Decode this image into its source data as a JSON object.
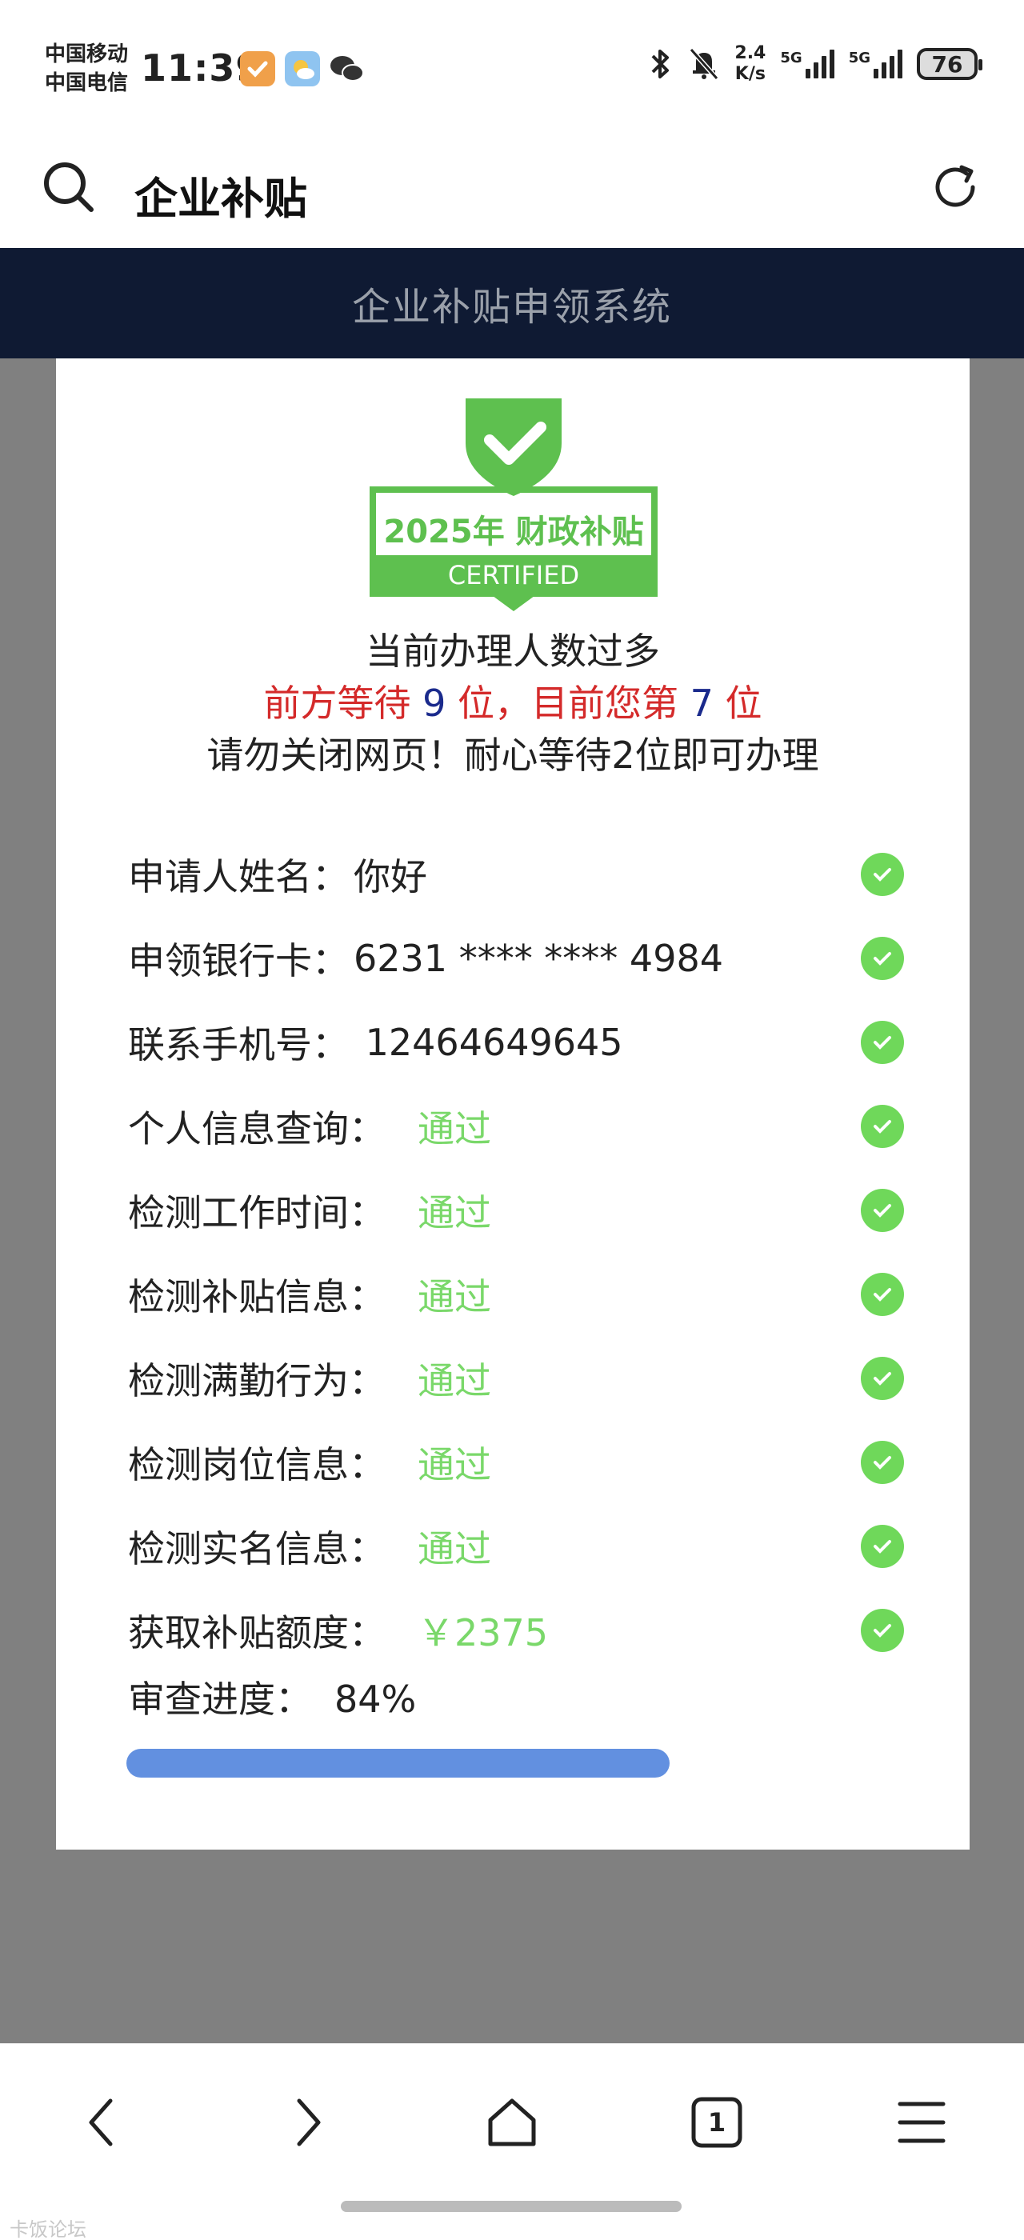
{
  "status_bar": {
    "carrier_1": "中国移动",
    "carrier_2": "中国电信",
    "time": "11:39",
    "net_speed_value": "2.4",
    "net_speed_unit": "K/s",
    "signal_1_label": "5G",
    "signal_2_label": "5G",
    "battery": "76",
    "icons": [
      "app-notification-icon",
      "weather-icon",
      "wechat-icon",
      "bluetooth-icon",
      "mute-bell-icon"
    ]
  },
  "header": {
    "title": "企业补贴",
    "icons": [
      "search-icon",
      "refresh-icon"
    ]
  },
  "banner": {
    "title": "企业补贴申领系统"
  },
  "certificate": {
    "year_text": "2025年 财政补贴",
    "certified_text": "CERTIFIED",
    "color": "#5ec04f"
  },
  "queue": {
    "line1": "当前办理人数过多",
    "line2_a": "前方等待 ",
    "ahead": "9",
    "line2_b": " 位，目前您第 ",
    "position": "7",
    "line2_c": " 位",
    "line3": "请勿关闭网页！耐心等待2位即可办理"
  },
  "rows": [
    {
      "label": "申请人姓名：",
      "value": "你好",
      "green": false
    },
    {
      "label": "申领银行卡：",
      "value": "6231 **** **** 4984",
      "green": false
    },
    {
      "label": "联系手机号：",
      "value": " 12464649645",
      "green": false
    },
    {
      "label": "个人信息查询：",
      "value": "通过",
      "green": true
    },
    {
      "label": "检测工作时间：",
      "value": "通过",
      "green": true
    },
    {
      "label": "检测补贴信息：",
      "value": "通过",
      "green": true
    },
    {
      "label": "检测满勤行为：",
      "value": "通过",
      "green": true
    },
    {
      "label": "检测岗位信息：",
      "value": "通过",
      "green": true
    },
    {
      "label": "检测实名信息：",
      "value": "通过",
      "green": true
    },
    {
      "label": "获取补贴额度：",
      "value": "￥2375",
      "green": true
    }
  ],
  "progress": {
    "label": "审查进度：",
    "percent_text": "84%",
    "percent": 84,
    "color": "#6290e0"
  },
  "bottom_nav": {
    "tab_count": "1",
    "icons": [
      "back-icon",
      "forward-icon",
      "home-icon",
      "tabs-icon",
      "menu-icon"
    ]
  },
  "watermark": "卡饭论坛"
}
